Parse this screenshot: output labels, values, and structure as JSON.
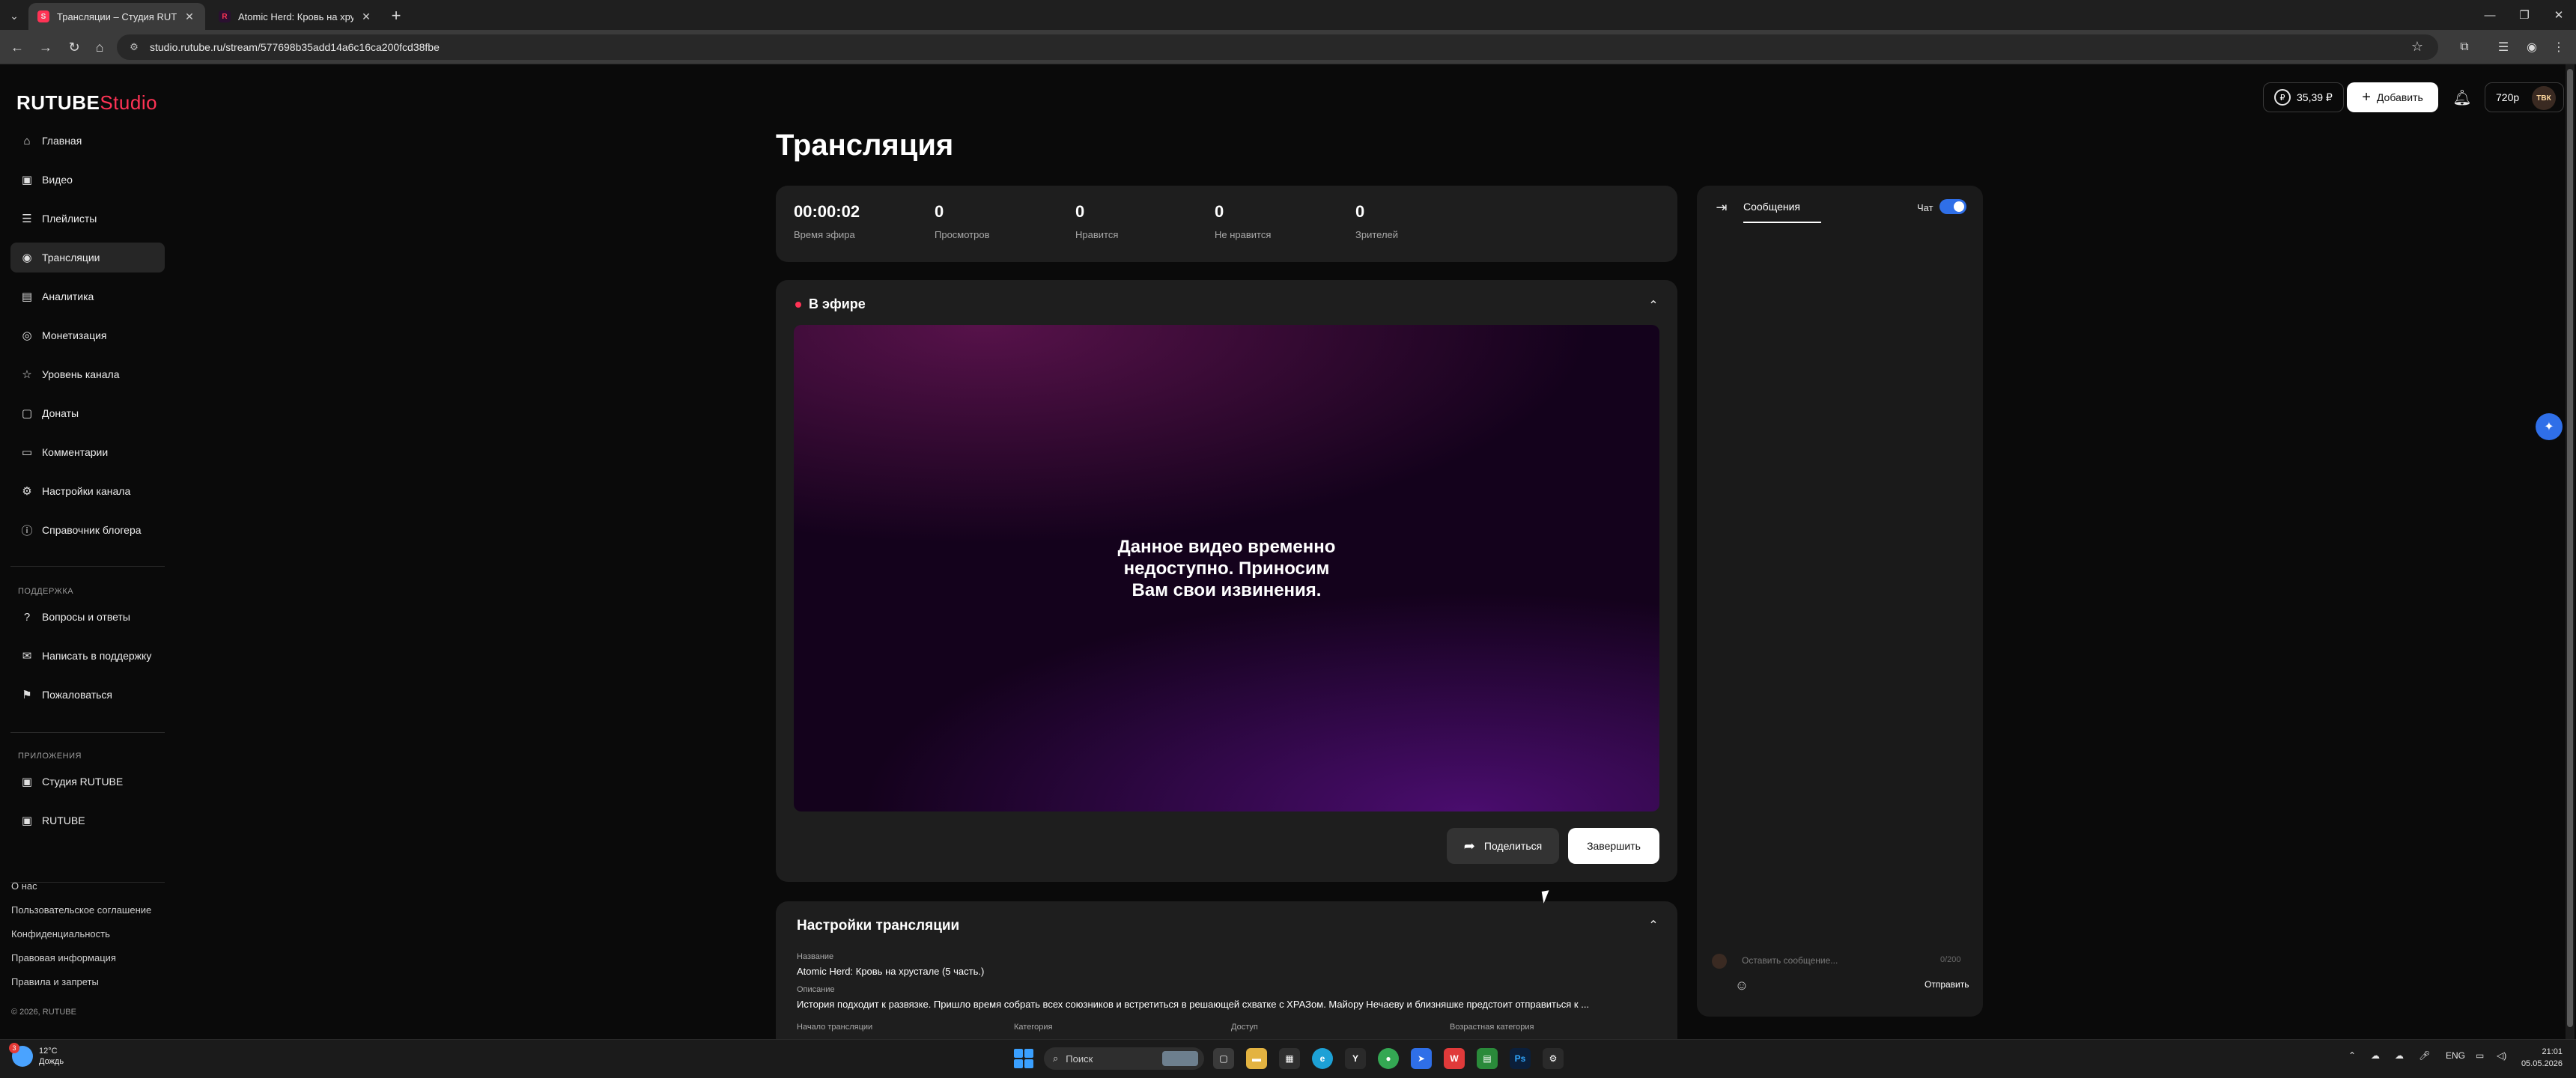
{
  "browser": {
    "tabs": [
      {
        "title": "Трансляции – Студия RUTUBE",
        "active": true
      },
      {
        "title": "Atomic Herd: Кровь на хрусталe",
        "active": false
      }
    ],
    "url": "studio.rutube.ru/stream/577698b35add14a6c16ca200fcd38fbe"
  },
  "logo": {
    "part1": "RUTUBE",
    "part2": "Studio"
  },
  "sidebar": {
    "items": [
      {
        "label": "Главная",
        "icon": "home-icon"
      },
      {
        "label": "Видео",
        "icon": "video-icon"
      },
      {
        "label": "Плейлисты",
        "icon": "playlist-icon"
      },
      {
        "label": "Трансляции",
        "icon": "broadcast-icon",
        "active": true
      },
      {
        "label": "Аналитика",
        "icon": "analytics-icon"
      },
      {
        "label": "Монетизация",
        "icon": "money-icon"
      },
      {
        "label": "Уровень канала",
        "icon": "star-icon"
      },
      {
        "label": "Донаты",
        "icon": "donate-icon"
      },
      {
        "label": "Комментарии",
        "icon": "comment-icon"
      },
      {
        "label": "Настройки канала",
        "icon": "gear-icon"
      },
      {
        "label": "Справочник блогера",
        "icon": "info-icon"
      }
    ],
    "support_label": "ПОДДЕРЖКА",
    "support_items": [
      {
        "label": "Вопросы и ответы",
        "icon": "question-icon"
      },
      {
        "label": "Написать в поддержку",
        "icon": "mail-icon"
      },
      {
        "label": "Пожаловаться",
        "icon": "flag-icon"
      }
    ],
    "apps_label": "ПРИЛОЖЕНИЯ",
    "apps_items": [
      {
        "label": "Студия RUTUBE",
        "icon": "app-icon"
      },
      {
        "label": "RUTUBE",
        "icon": "app-icon"
      }
    ],
    "footer_links": [
      "О нас",
      "Пользовательское соглашение",
      "Конфиденциальность",
      "Правовая информация",
      "Правила и запреты"
    ],
    "copyright": "© 2026, RUTUBE"
  },
  "header": {
    "balance": "35,39 ₽",
    "add_label": "Добавить",
    "quality": "720p",
    "avatar_text": "ТВК"
  },
  "page_title": "Трансляция",
  "stats": [
    {
      "value": "00:00:02",
      "label": "Время эфира"
    },
    {
      "value": "0",
      "label": "Просмотров"
    },
    {
      "value": "0",
      "label": "Нравится"
    },
    {
      "value": "0",
      "label": "Не нравится"
    },
    {
      "value": "0",
      "label": "Зрителей"
    }
  ],
  "live": {
    "title": "В эфире",
    "unavailable_text": "Данное видео временно недоступно. Приносим Вам свои извинения.",
    "share_label": "Поделиться",
    "end_label": "Завершить"
  },
  "settings": {
    "title": "Настройки трансляции",
    "name_label": "Название",
    "name_value": "Atomic Herd: Кровь на хрустале (5 часть.)",
    "description_label": "Описание",
    "description_value": "История подходит к развязке. Пришло время собрать всех союзников и встретиться в решающей схватке с ХРАЗом. Майору Нечаеву и близняшке предстоит отправиться к ...",
    "start_label": "Начало трансляции",
    "category_label": "Категория",
    "access_label": "Доступ",
    "age_label": "Возрастная категория"
  },
  "chat": {
    "tab_label": "Сообщения",
    "toggle_label": "Чат",
    "toggle_on": true,
    "input_placeholder": "Оставить сообщение...",
    "counter": "0/200",
    "send_label": "Отправить"
  },
  "taskbar": {
    "weather_temp": "12°C",
    "weather_desc": "Дождь",
    "weather_badge": "3",
    "search_placeholder": "Поиск",
    "lang": "ENG",
    "time": "21:01",
    "date": "05.05.2026"
  }
}
